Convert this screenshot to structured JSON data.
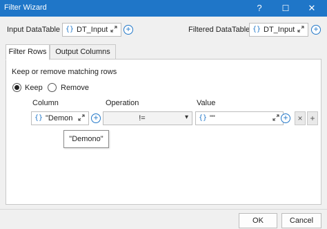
{
  "window": {
    "title": "Filter Wizard",
    "help_glyph": "?",
    "maximize_glyph": "☐",
    "close_glyph": "✕"
  },
  "input_datatable": {
    "label": "Input DataTable",
    "value": "DT_Input"
  },
  "filtered_datatable": {
    "label": "Filtered DataTable",
    "value": "DT_Input"
  },
  "tabs": [
    {
      "label": "Filter Rows",
      "active": true
    },
    {
      "label": "Output Columns",
      "active": false
    }
  ],
  "filter": {
    "description": "Keep or remove matching rows",
    "keep_label": "Keep",
    "remove_label": "Remove",
    "selected": "Keep",
    "headers": {
      "column": "Column",
      "operation": "Operation",
      "value": "Value"
    },
    "row": {
      "column": "\"Demono",
      "operation": "!=",
      "value": "\"\"",
      "remove_glyph": "×",
      "add_glyph": "+"
    },
    "tooltip": "\"Demono\""
  },
  "footer": {
    "ok_label": "OK",
    "cancel_label": "Cancel"
  },
  "icons": {
    "brace": "{}",
    "expand": "expand-icon",
    "add": "add-circle-icon",
    "dropdown": "chevron-down-icon"
  },
  "colors": {
    "titlebar": "#1f76c8",
    "accent": "#1f76c8"
  }
}
